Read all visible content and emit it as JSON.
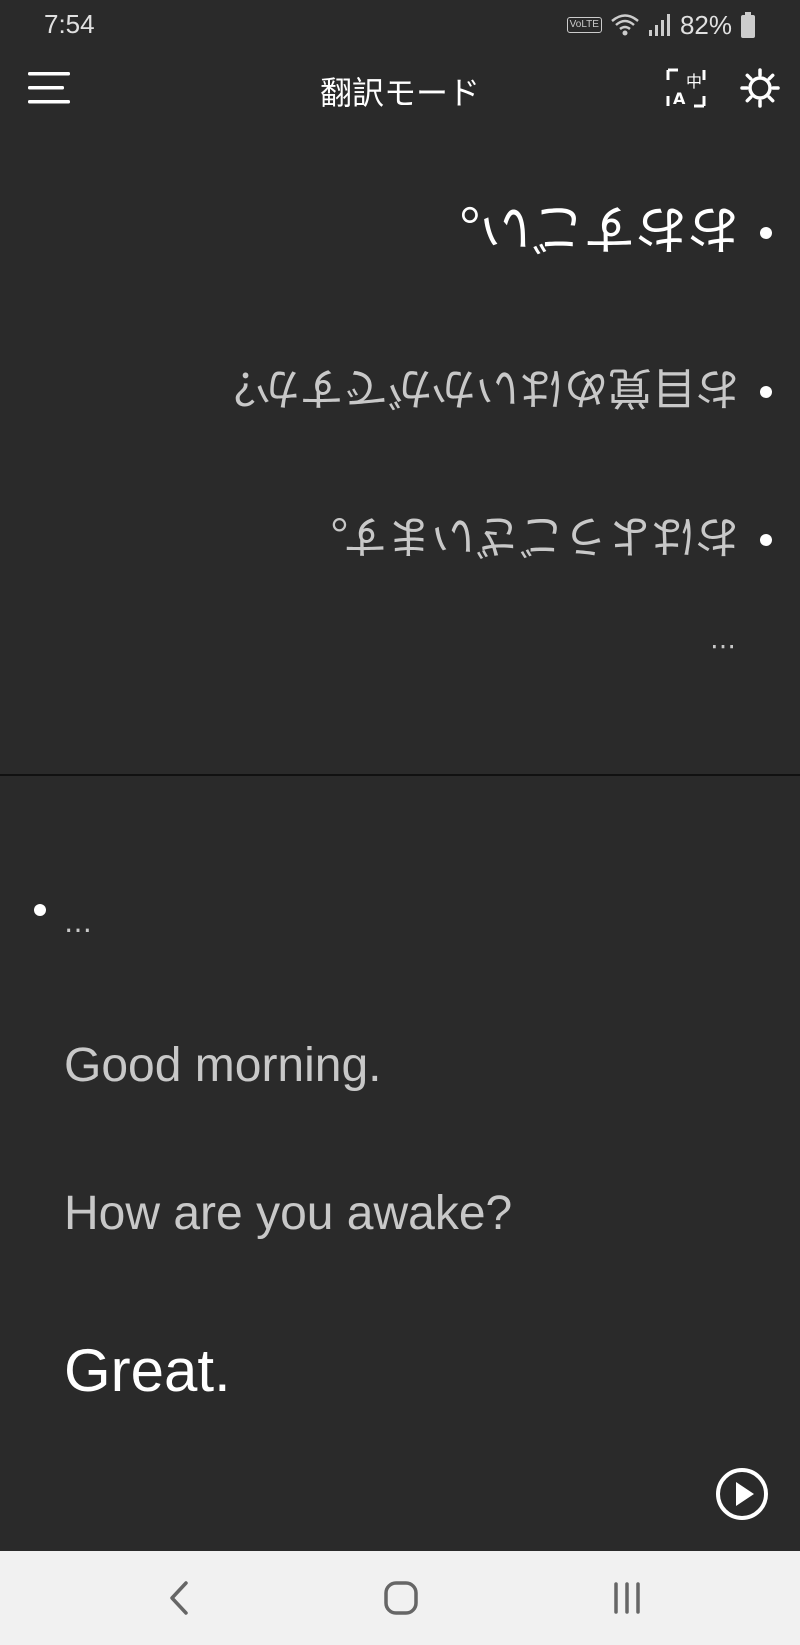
{
  "status_bar": {
    "time": "7:54",
    "network_badge": "VoLTE",
    "battery_percent": "82%",
    "icons": [
      "volte-icon",
      "wifi-icon",
      "signal-icon",
      "battery-icon"
    ]
  },
  "app_bar": {
    "title": "翻訳モード",
    "menu_icon": "hamburger-menu-icon",
    "translate_icon": "translate-icon",
    "settings_icon": "gear-icon"
  },
  "upper_pane": {
    "lines": [
      "おおすごい。",
      "お目覚めはいかがですか？",
      "おはようございます。"
    ],
    "ellipsis": "…"
  },
  "lower_pane": {
    "ellipsis": "…",
    "lines": [
      "Good morning.",
      "How are you awake?",
      "Great."
    ],
    "play_icon": "play-circle-icon"
  },
  "nav_bar": {
    "icons": [
      "back-icon",
      "home-icon",
      "recents-icon"
    ]
  },
  "colors": {
    "background": "#2a2a2a",
    "text_primary": "#ffffff",
    "text_secondary": "#c8c8c8",
    "nav_background": "#f1f1f1"
  }
}
